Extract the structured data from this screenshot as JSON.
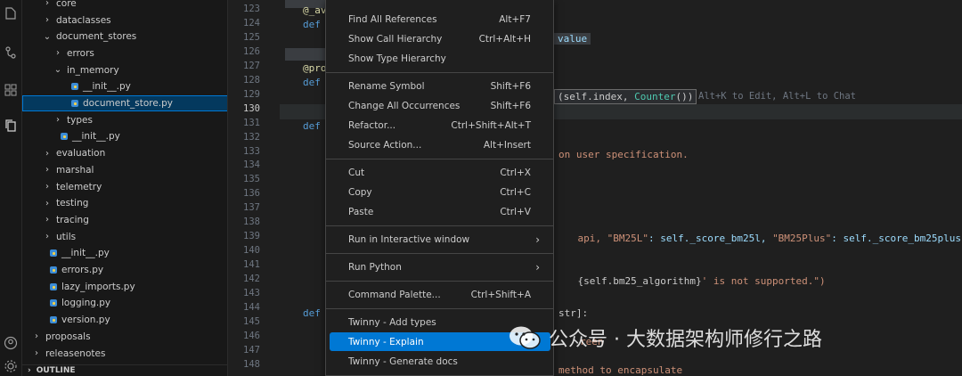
{
  "activity_icons": [
    "explorer-icon",
    "source-control-icon",
    "run-debug-icon",
    "extensions-icon",
    "copy-icon",
    "account-icon",
    "settings-icon"
  ],
  "explorer": {
    "tree": [
      {
        "label": "core",
        "kind": "folder",
        "expanded": false,
        "depth": 1
      },
      {
        "label": "dataclasses",
        "kind": "folder",
        "expanded": false,
        "depth": 1
      },
      {
        "label": "document_stores",
        "kind": "folder",
        "expanded": true,
        "depth": 1
      },
      {
        "label": "errors",
        "kind": "folder",
        "expanded": false,
        "depth": 2
      },
      {
        "label": "in_memory",
        "kind": "folder",
        "expanded": true,
        "depth": 2
      },
      {
        "label": "__init__.py",
        "kind": "py",
        "depth": 3
      },
      {
        "label": "document_store.py",
        "kind": "py",
        "depth": 3,
        "selected": true
      },
      {
        "label": "types",
        "kind": "folder",
        "expanded": false,
        "depth": 2
      },
      {
        "label": "__init__.py",
        "kind": "py",
        "depth": 2
      },
      {
        "label": "evaluation",
        "kind": "folder",
        "expanded": false,
        "depth": 1
      },
      {
        "label": "marshal",
        "kind": "folder",
        "expanded": false,
        "depth": 1
      },
      {
        "label": "telemetry",
        "kind": "folder",
        "expanded": false,
        "depth": 1
      },
      {
        "label": "testing",
        "kind": "folder",
        "expanded": false,
        "depth": 1
      },
      {
        "label": "tracing",
        "kind": "folder",
        "expanded": false,
        "depth": 1
      },
      {
        "label": "utils",
        "kind": "folder",
        "expanded": false,
        "depth": 1
      },
      {
        "label": "__init__.py",
        "kind": "py",
        "depth": 1
      },
      {
        "label": "errors.py",
        "kind": "py",
        "depth": 1
      },
      {
        "label": "lazy_imports.py",
        "kind": "py",
        "depth": 1
      },
      {
        "label": "logging.py",
        "kind": "py",
        "depth": 1
      },
      {
        "label": "version.py",
        "kind": "py",
        "depth": 1
      },
      {
        "label": "proposals",
        "kind": "folder",
        "expanded": false,
        "depth": 0
      },
      {
        "label": "releasenotes",
        "kind": "folder",
        "expanded": false,
        "depth": 0
      }
    ],
    "outline_label": "OUTLINE"
  },
  "editor": {
    "line_numbers": [
      "123",
      "124",
      "125",
      "126",
      "127",
      "128",
      "129",
      "130",
      "131",
      "132",
      "133",
      "134",
      "135",
      "136",
      "137",
      "138",
      "139",
      "140",
      "141",
      "142",
      "143",
      "144",
      "145",
      "146",
      "147",
      "148"
    ],
    "current_line": "130",
    "fragments": {
      "l123_dec": "@_av",
      "l124_def": "def",
      "l125_value": "value",
      "l127_dec": "@pro",
      "l128_def": "def",
      "l129_code_a": "(self.index, ",
      "l129_code_b": "Counter",
      "l129_code_c": "())",
      "l129_hint": "Alt+K to Edit, Alt+L to Chat",
      "l131_def": "def",
      "l133_text": "on user specification.",
      "l138_a": "api, ",
      "l138_b": "\"BM25L\"",
      "l138_c": ": self._score_bm25l, ",
      "l138_d": "\"BM25Plus\"",
      "l138_e": ": self._score_bm25plus}",
      "l141_a": "{self.bm25_algorithm}",
      "l141_b": "' is not supported.\")",
      "l144_def": "def",
      "l144_text": "str]:",
      "l146_text": "reen",
      "l148_text": "method to encapsulate"
    }
  },
  "context_menu": {
    "groups": [
      [
        {
          "label": "Find All References",
          "shortcut": "Alt+F7"
        },
        {
          "label": "Show Call Hierarchy",
          "shortcut": "Ctrl+Alt+H"
        },
        {
          "label": "Show Type Hierarchy",
          "shortcut": ""
        }
      ],
      [
        {
          "label": "Rename Symbol",
          "shortcut": "Shift+F6"
        },
        {
          "label": "Change All Occurrences",
          "shortcut": "Shift+F6"
        },
        {
          "label": "Refactor...",
          "shortcut": "Ctrl+Shift+Alt+T"
        },
        {
          "label": "Source Action...",
          "shortcut": "Alt+Insert"
        }
      ],
      [
        {
          "label": "Cut",
          "shortcut": "Ctrl+X"
        },
        {
          "label": "Copy",
          "shortcut": "Ctrl+C"
        },
        {
          "label": "Paste",
          "shortcut": "Ctrl+V"
        }
      ],
      [
        {
          "label": "Run in Interactive window",
          "shortcut": "",
          "submenu": true
        }
      ],
      [
        {
          "label": "Run Python",
          "shortcut": "",
          "submenu": true
        }
      ],
      [
        {
          "label": "Command Palette...",
          "shortcut": "Ctrl+Shift+A"
        }
      ],
      [
        {
          "label": "Twinny - Add types",
          "shortcut": ""
        },
        {
          "label": "Twinny - Explain",
          "shortcut": "",
          "active": true
        },
        {
          "label": "Twinny - Generate docs",
          "shortcut": ""
        }
      ]
    ]
  },
  "watermark": {
    "text": "公众号 · 大数据架构师修行之路"
  },
  "colors": {
    "accent": "#0078d4",
    "selection": "#04395e",
    "background": "#1f1f1f"
  }
}
